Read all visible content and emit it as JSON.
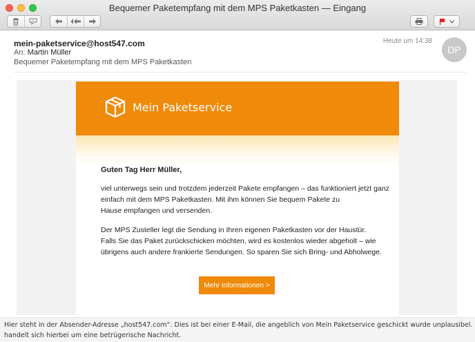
{
  "window": {
    "title": "Bequemer Paketempfang mit dem MPS Paketkasten — Eingang"
  },
  "toolbar": {
    "icons": [
      "trash-icon",
      "junk-icon",
      "reply-icon",
      "reply-all-icon",
      "forward-icon",
      "print-icon",
      "flag-icon"
    ],
    "flag_color": "#e02020"
  },
  "message": {
    "from": "mein-paketservice@host547.com",
    "to_label": "An:",
    "to": "Martin Müller",
    "subject": "Bequemer Paketempfang mit dem MPS Paketkasten",
    "time": "Heute um 14:38",
    "avatar_initials": "DP"
  },
  "email": {
    "brand_color": "#ef8a0a",
    "logo_text": "Mein Paketservice",
    "greeting": "Guten Tag Herr Müller,",
    "paragraph1": [
      "viel unterwegs sein und trotzdem jederzeit Pakete empfangen – das funktioniert jetzt ganz",
      "einfach mit dem MPS Paketkasten. Mit ihm können Sie bequem Pakete zu",
      "Hause empfangen und versenden."
    ],
    "paragraph2": [
      "Der MPS Zusteller legt die Sendung in Ihren eigenen Paketkasten vor der Haustür.",
      "Falls Sie das Paket zurückschicken möchten, wird es kostenlos wieder abgeholt – wie",
      "übrigens auch andere frankierte Sendungen. So sparen Sie sich Bring- und Abholwege."
    ],
    "cta_label": "Mehr Informationen >"
  },
  "caption": {
    "lines": [
      "Hier steht in der Absender-Adresse „host547.com“. Dies ist bei einer E-Mail, die angeblich von Mein Paketservice geschickt wurde unplausibel. Es",
      "handelt sich hierbei um eine betrügerische Nachricht."
    ]
  }
}
